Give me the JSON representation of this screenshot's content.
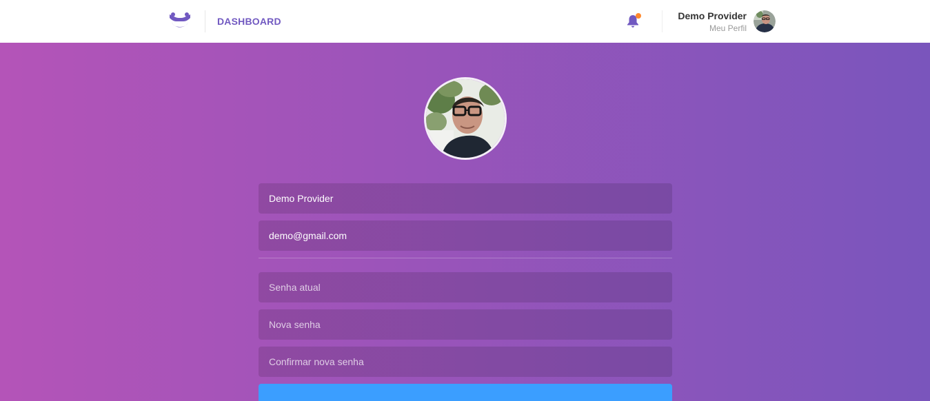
{
  "header": {
    "logo_icon": "barber-mustache-logo",
    "dashboard_label": "DASHBOARD",
    "notifications_icon": "bell-icon",
    "has_unread": true,
    "profile_name": "Demo Provider",
    "profile_link": "Meu Perfil"
  },
  "profile_form": {
    "name_value": "Demo Provider",
    "email_value": "demo@gmail.com",
    "old_password_placeholder": "Senha atual",
    "new_password_placeholder": "Nova senha",
    "confirm_password_placeholder": "Confirmar nova senha"
  },
  "colors": {
    "accent": "#7159c1",
    "notification_dot": "#ff892e",
    "gradient_start": "#b454b8",
    "gradient_end": "#7a55bc",
    "submit_button": "#3b9eff"
  }
}
